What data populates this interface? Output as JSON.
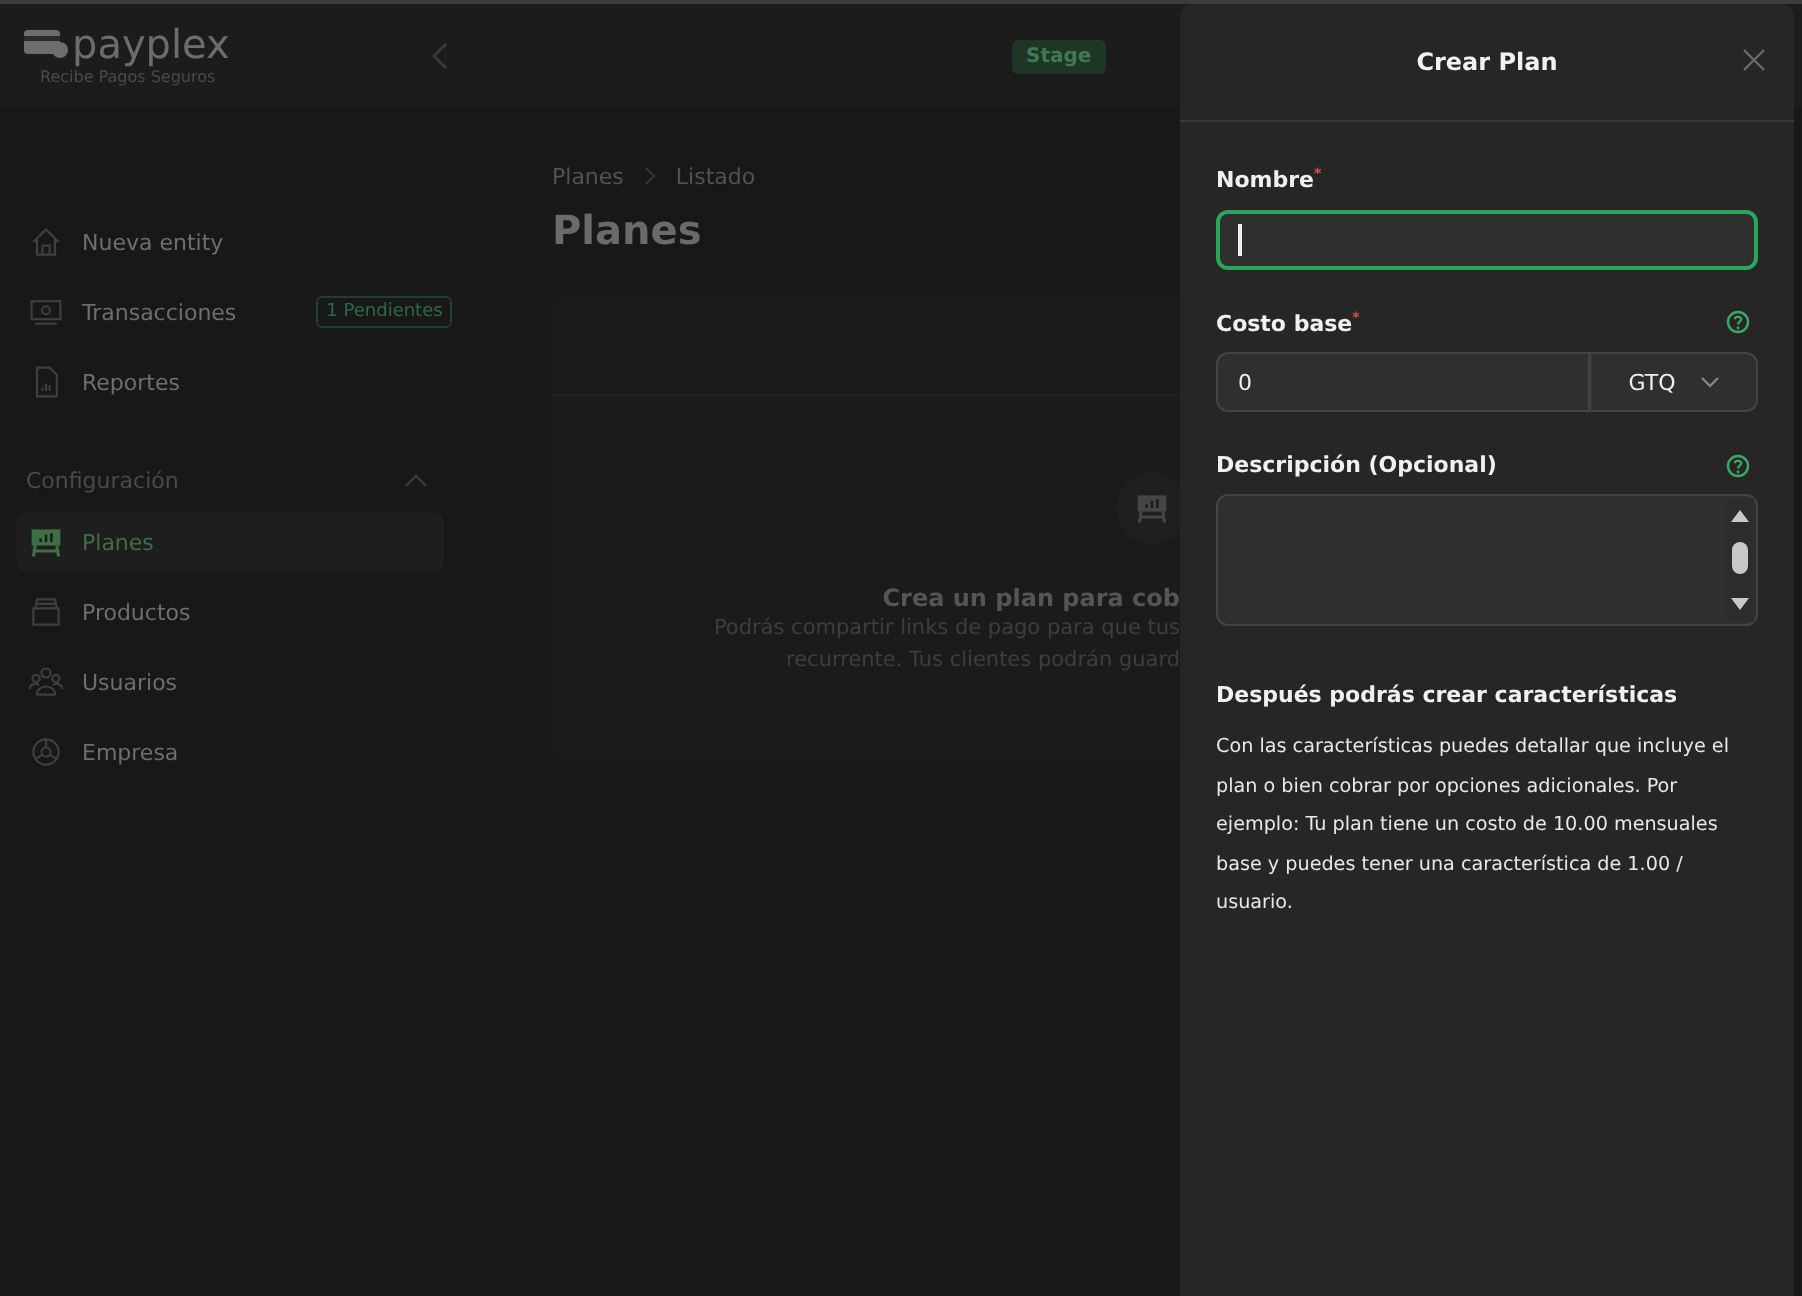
{
  "header": {
    "logo": "payplex",
    "tagline": "Recibe Pagos Seguros",
    "environment_badge": "Stage"
  },
  "sidebar": {
    "items": [
      {
        "label": "Nueva entity",
        "selected": false
      },
      {
        "label": "Transacciones",
        "selected": false,
        "badge": "1 Pendientes"
      },
      {
        "label": "Reportes",
        "selected": false
      }
    ],
    "section": {
      "title": "Configuración",
      "expanded": true,
      "items": [
        {
          "label": "Planes",
          "selected": true
        },
        {
          "label": "Productos",
          "selected": false
        },
        {
          "label": "Usuarios",
          "selected": false
        },
        {
          "label": "Empresa",
          "selected": false
        }
      ]
    }
  },
  "breadcrumb": [
    "Planes",
    "Listado"
  ],
  "page_title": "Planes",
  "empty_state": {
    "title": "Crea un plan para cob",
    "lines": [
      "Podrás compartir links de pago para que tus",
      "recurrente. Tus clientes podrán guard"
    ]
  },
  "drawer": {
    "title": "Crear Plan",
    "fields": [
      {
        "kind": "text",
        "label": "Nombre",
        "required_mark": "*",
        "help": false,
        "focused": true
      },
      {
        "kind": "amount",
        "label": "Costo base",
        "required_mark": "*",
        "help": true,
        "focused": false,
        "value": "0",
        "currency": "GTQ"
      },
      {
        "kind": "textarea",
        "label": "Descripción (Opcional)",
        "help": true,
        "focused": false
      }
    ],
    "note": {
      "title": "Después podrás crear características",
      "text": "Con las características puedes detallar que incluye el plan o bien cobrar por opciones adicionales. Por ejemplo: Tu plan tiene un costo de 10.00 mensuales base y puedes tener una característica de 1.00 / usuario."
    }
  }
}
